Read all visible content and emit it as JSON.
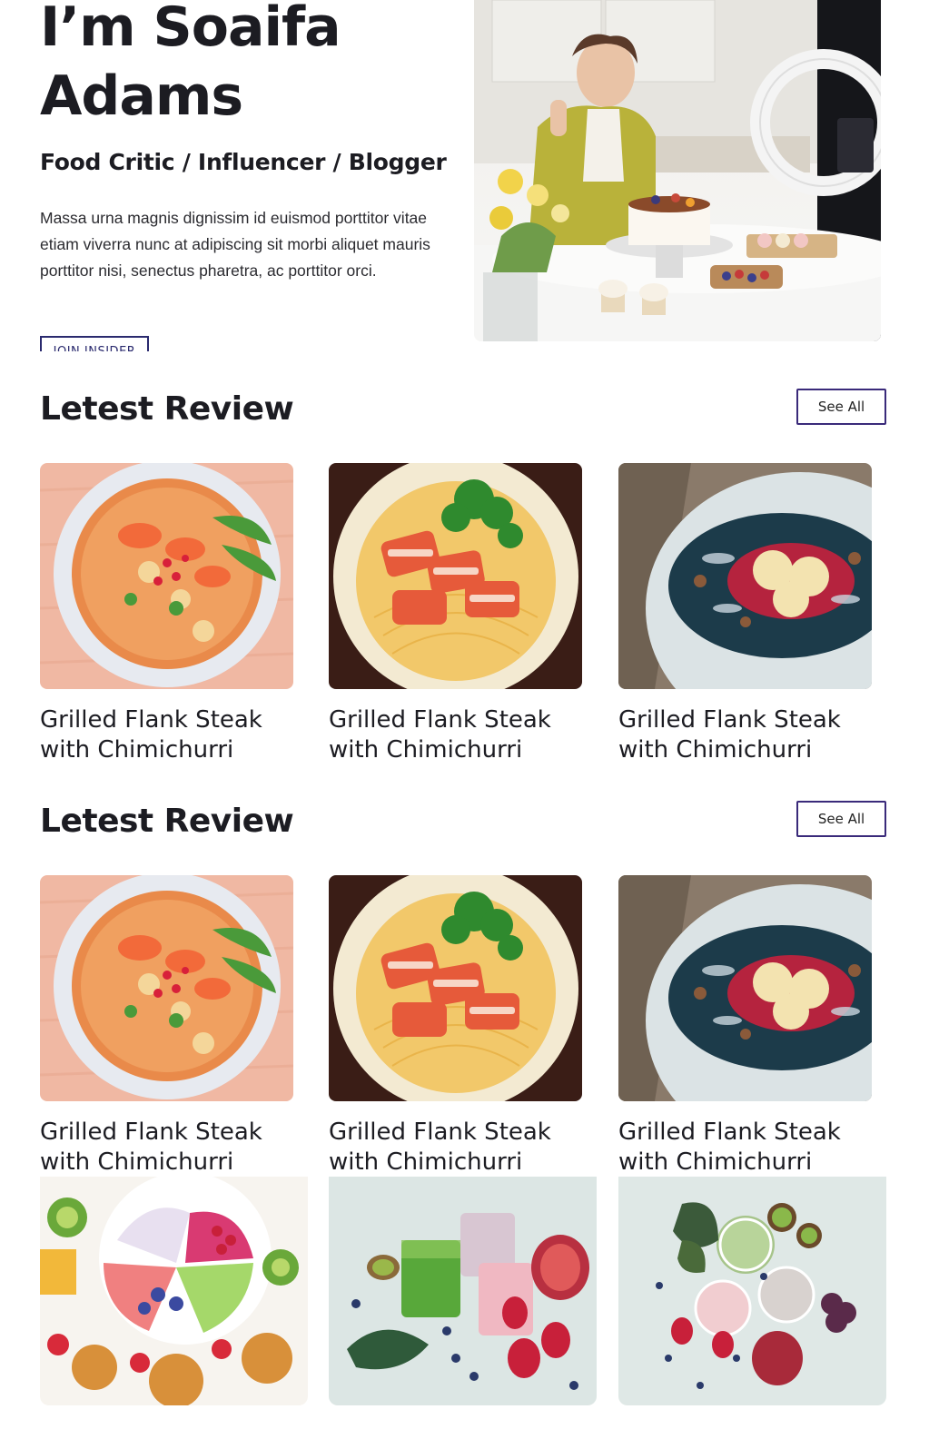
{
  "hero": {
    "title": "I’m Soaifa Adams",
    "subtitle": "Food Critic / Influencer / Blogger",
    "description": "Massa urna magnis dignissim id euismod porttitor vitae etiam viverra nunc at adipiscing sit morbi aliquet mauris porttitor nisi, senectus pharetra, ac porttitor orci.",
    "join_label": "JOIN INSIDER",
    "photo_icon": "woman-cooking-photo"
  },
  "sections": [
    {
      "title": "Letest Review",
      "see_all_label": "See All",
      "cards": [
        {
          "title": "Grilled Flank Steak with Chimichurri",
          "image": "noodle-soup-photo"
        },
        {
          "title": "Grilled Flank Steak with Chimichurri",
          "image": "pork-noodles-photo"
        },
        {
          "title": "Grilled Flank Steak with Chimichurri",
          "image": "ravioli-plate-photo"
        }
      ]
    },
    {
      "title": "Letest Review",
      "see_all_label": "See All",
      "cards": [
        {
          "title": "Grilled Flank Steak with Chimichurri",
          "image": "noodle-soup-photo"
        },
        {
          "title": "Grilled Flank Steak with Chimichurri",
          "image": "pork-noodles-photo"
        },
        {
          "title": "Grilled Flank Steak with Chimichurri",
          "image": "ravioli-plate-photo"
        }
      ]
    }
  ],
  "gallery": [
    {
      "image": "fruit-bowl-photo"
    },
    {
      "image": "green-smoothies-photo"
    },
    {
      "image": "smoothie-glasses-photo"
    }
  ],
  "colors": {
    "text": "#1c1c22",
    "button_border": "#3a2a7a",
    "join_border": "#2a2a6e"
  }
}
